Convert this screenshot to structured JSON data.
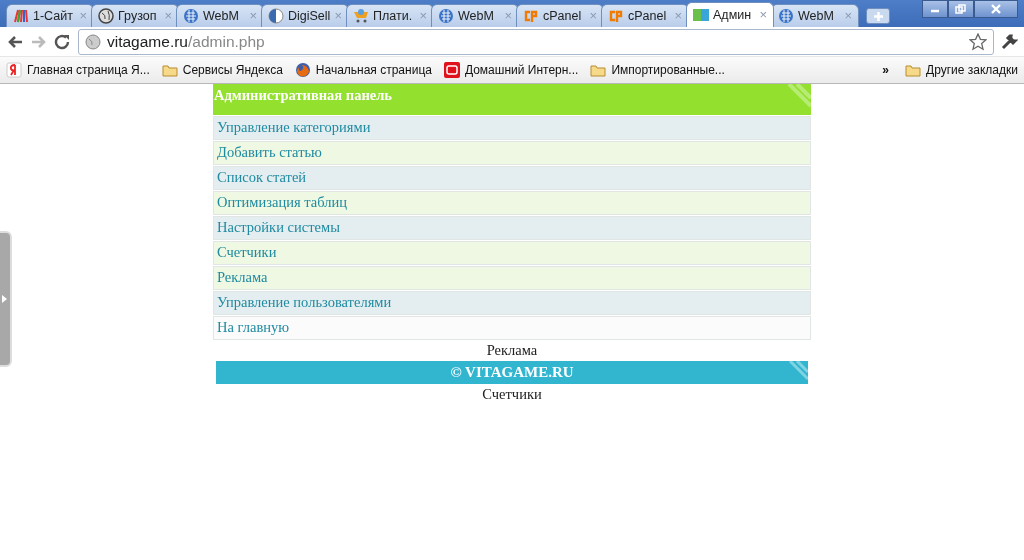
{
  "tabs": [
    {
      "label": "1-Сайт",
      "selected": false,
      "close": "×"
    },
    {
      "label": "Грузоп",
      "selected": false,
      "close": "×"
    },
    {
      "label": "WebM",
      "selected": false,
      "close": "×"
    },
    {
      "label": "DigiSell",
      "selected": false,
      "close": "×"
    },
    {
      "label": "Плати.",
      "selected": false,
      "close": "×"
    },
    {
      "label": "WebM",
      "selected": false,
      "close": "×"
    },
    {
      "label": "cPanel",
      "selected": false,
      "close": "×"
    },
    {
      "label": "cPanel",
      "selected": false,
      "close": "×"
    },
    {
      "label": "Админ",
      "selected": true,
      "close": "×"
    },
    {
      "label": "WebM",
      "selected": false,
      "close": "×"
    }
  ],
  "address": {
    "host": "vitagame.ru",
    "path": "/admin.php"
  },
  "bookmarks": [
    {
      "label": "Главная страница Я..."
    },
    {
      "label": "Сервисы Яндекса"
    },
    {
      "label": "Начальная страница"
    },
    {
      "label": "Домашний Интерн..."
    },
    {
      "label": "Импортированные..."
    }
  ],
  "bookmarks_more": "»",
  "other_bookmarks": "Другие закладки",
  "panel": {
    "title": "Административная панель",
    "items": [
      {
        "label": "Управление категориями",
        "color": "#e4eef1"
      },
      {
        "label": "Добавить статью",
        "color": "#eef8e2"
      },
      {
        "label": "Список статей",
        "color": "#e4eef1"
      },
      {
        "label": "Оптимизация таблиц",
        "color": "#eef8e2"
      },
      {
        "label": "Настройки системы",
        "color": "#e4eef1"
      },
      {
        "label": "Счетчики",
        "color": "#eef8e2"
      },
      {
        "label": "Реклама",
        "color": "#eef8e2"
      },
      {
        "label": "Управление пользователями",
        "color": "#e4eef1"
      },
      {
        "label": "На главную",
        "color": "#fbfbfb"
      }
    ]
  },
  "ad_label": "Реклама",
  "footer": "© VITAGAME.RU",
  "counters_label": "Счетчики"
}
